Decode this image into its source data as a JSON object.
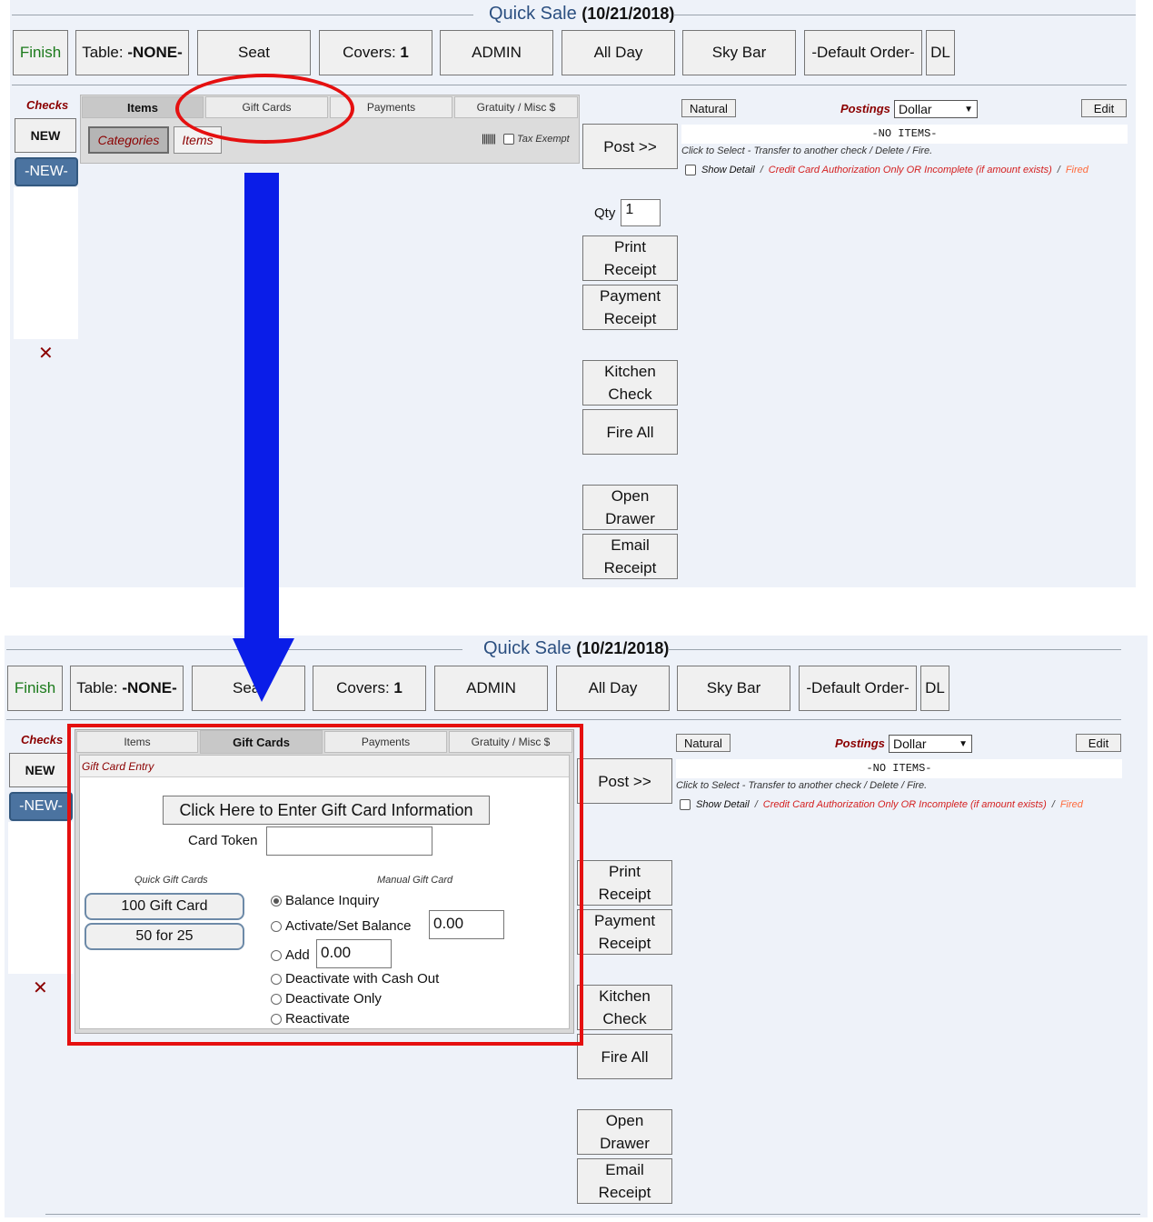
{
  "header": {
    "title": "Quick Sale",
    "date": "(10/21/2018)"
  },
  "toolbar": {
    "finish": "Finish",
    "table_label": "Table:",
    "table_value": "-NONE-",
    "seat": "Seat",
    "covers_label": "Covers:",
    "covers_value": "1",
    "admin": "ADMIN",
    "all_day": "All Day",
    "sky_bar": "Sky Bar",
    "default_order": "-Default Order-",
    "dl": "DL"
  },
  "checks": {
    "label": "Checks",
    "new_button": "NEW",
    "new_check": "-NEW-",
    "delete_glyph": "✕"
  },
  "tabs": {
    "items": "Items",
    "gift_cards": "Gift Cards",
    "payments": "Payments",
    "gratuity": "Gratuity / Misc $"
  },
  "items_panel": {
    "categories": "Categories",
    "items": "Items",
    "barcode_glyph": "|||||||",
    "tax_exempt": "Tax Exempt"
  },
  "actions": {
    "post": "Post >>",
    "qty_label": "Qty",
    "qty_value": "1",
    "print_receipt": "Print Receipt",
    "payment_receipt": "Payment Receipt",
    "kitchen_check": "Kitchen Check",
    "fire_all": "Fire All",
    "open_drawer": "Open Drawer",
    "email_receipt": "Email Receipt"
  },
  "order": {
    "natural": "Natural",
    "postings": "Postings",
    "postings_value": "Dollar",
    "edit": "Edit",
    "no_items": "-NO ITEMS-",
    "click_select": "Click to Select - Transfer to another check / Delete / Fire.",
    "show_detail": "Show Detail",
    "sep": "/",
    "cc_auth": "Credit Card Authorization Only OR Incomplete (if amount exists)",
    "fired": "Fired"
  },
  "gift_card": {
    "entry_label": "Gift Card Entry",
    "enter_button": "Click Here to Enter Gift Card Information",
    "card_token": "Card Token",
    "quick_label": "Quick Gift Cards",
    "manual_label": "Manual Gift Card",
    "quick_cards": [
      "100 Gift Card",
      "50 for 25"
    ],
    "balance_inquiry": "Balance Inquiry",
    "activate": "Activate/Set Balance",
    "activate_value": "0.00",
    "add": "Add",
    "add_value": "0.00",
    "deactivate_cash": "Deactivate with Cash Out",
    "deactivate_only": "Deactivate Only",
    "reactivate": "Reactivate"
  },
  "colors": {
    "annotation_red": "#e51010",
    "annotation_blue": "#0a1de8",
    "check_blue": "#4b73a0"
  }
}
